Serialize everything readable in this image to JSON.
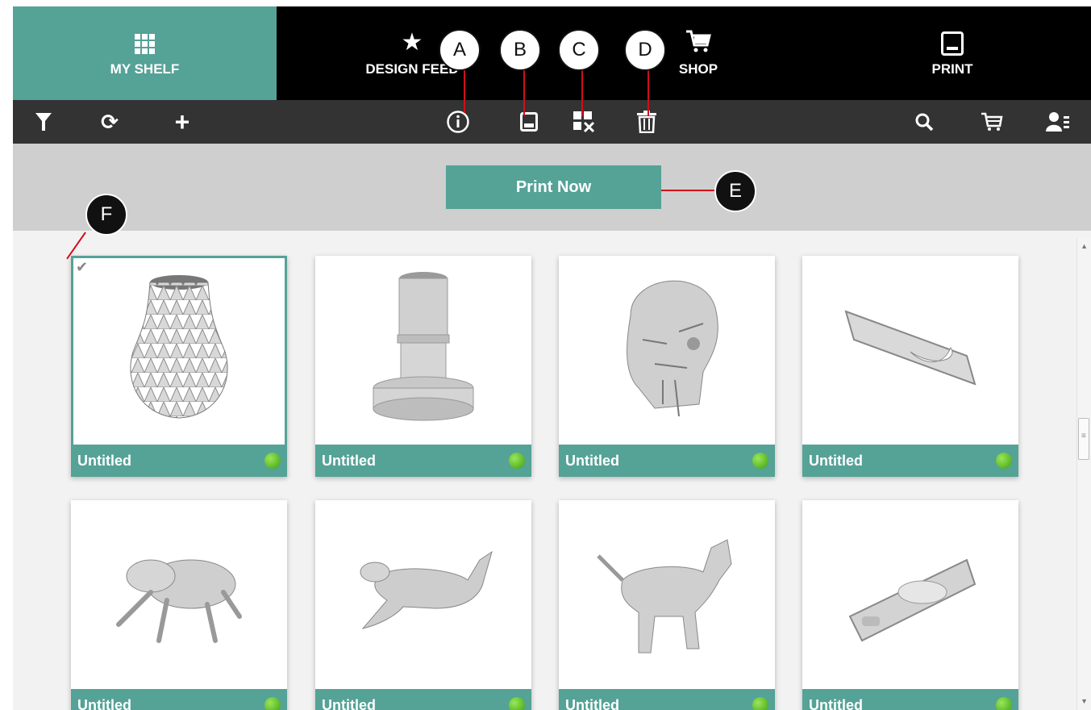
{
  "nav": {
    "tabs": [
      {
        "label": "MY SHELF",
        "icon": "grid-icon",
        "active": true
      },
      {
        "label": "DESIGN FEED",
        "icon": "star-icon",
        "active": false
      },
      {
        "label": "SHOP",
        "icon": "cart-icon",
        "active": false
      },
      {
        "label": "PRINT",
        "icon": "printer-icon",
        "active": false
      }
    ]
  },
  "toolbar": {
    "left": [
      "filter-icon",
      "sync-icon",
      "add-icon"
    ],
    "center": [
      "info-icon",
      "save-icon",
      "remove-icon",
      "trash-icon"
    ],
    "right": [
      "search-icon",
      "cart-icon",
      "account-icon"
    ]
  },
  "print_now_label": "Print Now",
  "callouts": [
    "A",
    "B",
    "C",
    "D",
    "E",
    "F"
  ],
  "items": [
    {
      "title": "Untitled",
      "model": "faceted vase",
      "selected": true,
      "status": "ready"
    },
    {
      "title": "Untitled",
      "model": "stepped cylinder",
      "selected": false,
      "status": "ready"
    },
    {
      "title": "Untitled",
      "model": "robot skull",
      "selected": false,
      "status": "ready"
    },
    {
      "title": "Untitled",
      "model": "phone case",
      "selected": false,
      "status": "ready"
    },
    {
      "title": "Untitled",
      "model": "frog",
      "selected": false,
      "status": "ready"
    },
    {
      "title": "Untitled",
      "model": "bull",
      "selected": false,
      "status": "ready"
    },
    {
      "title": "Untitled",
      "model": "dog",
      "selected": false,
      "status": "ready"
    },
    {
      "title": "Untitled",
      "model": "phone case",
      "selected": false,
      "status": "ready"
    }
  ],
  "colors": {
    "accent": "#55a297",
    "nav_bg": "#000000",
    "toolbar_bg": "#333333",
    "status_dot": "#4cbb17",
    "callout_line": "#d0101a"
  }
}
